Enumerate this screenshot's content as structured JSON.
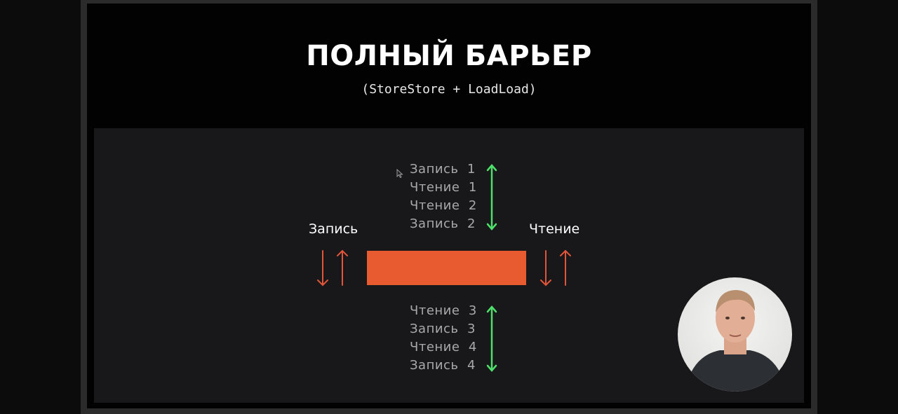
{
  "slide": {
    "title": "ПОЛНЫЙ БАРЬЕР",
    "subtitle": "(StoreStore + LoadLoad)",
    "above_ops": [
      "Запись  1",
      "Чтение  1",
      "Чтение  2",
      "Запись  2"
    ],
    "below_ops": [
      "Чтение  3",
      "Запись  3",
      "Чтение  4",
      "Запись  4"
    ],
    "left_label": "Запись",
    "right_label": "Чтение"
  },
  "colors": {
    "barrier": "#e85a30",
    "green_arrow": "#4ee06a",
    "red_arrow": "#e2553a"
  }
}
